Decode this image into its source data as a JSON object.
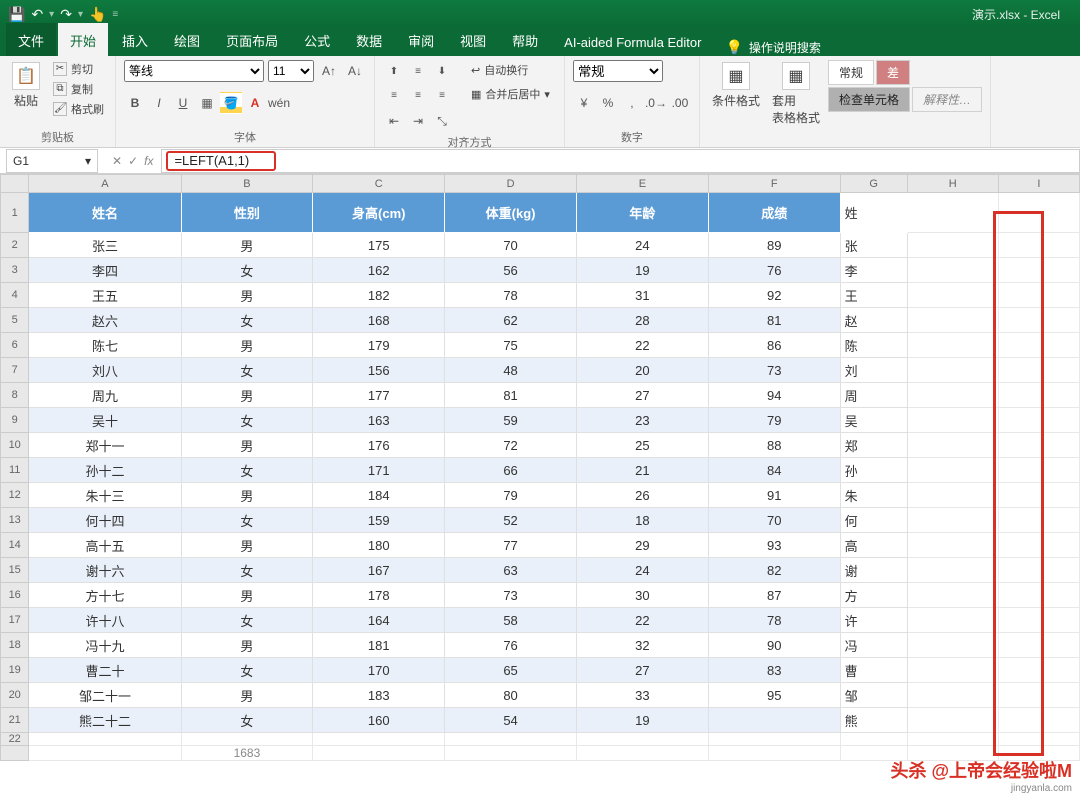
{
  "title": "演示.xlsx - Excel",
  "qat": {
    "save": "💾",
    "undo": "↶",
    "redo": "↷",
    "touch": "👆",
    "sep": "▾"
  },
  "tabs": {
    "file": "文件",
    "home": "开始",
    "insert": "插入",
    "draw": "绘图",
    "layout": "页面布局",
    "formulas": "公式",
    "data": "数据",
    "review": "审阅",
    "view": "视图",
    "help": "帮助",
    "ai": "AI-aided Formula Editor",
    "tell": "操作说明搜索"
  },
  "ribbon": {
    "clipboard": {
      "paste": "粘贴",
      "cut": "剪切",
      "copy": "复制",
      "painter": "格式刷",
      "label": "剪贴板"
    },
    "font": {
      "name": "等线",
      "size": "11",
      "label": "字体"
    },
    "align": {
      "wrap": "自动换行",
      "merge": "合并后居中",
      "label": "对齐方式"
    },
    "number": {
      "format": "常规",
      "label": "数字"
    },
    "styles": {
      "cond": "条件格式",
      "table": "套用\n表格格式",
      "normal": "常规",
      "bad": "差",
      "check": "检查单元格",
      "explain": "解释性…"
    }
  },
  "formula": {
    "cell": "G1",
    "value": "=LEFT(A1,1)"
  },
  "columns": [
    "",
    "A",
    "B",
    "C",
    "D",
    "E",
    "F",
    "G",
    "H",
    "I"
  ],
  "headers": [
    "姓名",
    "性别",
    "身高(cm)",
    "体重(kg)",
    "年龄",
    "成绩"
  ],
  "g_header": "姓",
  "rows": [
    {
      "r": 2,
      "a": "张三",
      "b": "男",
      "c": "175",
      "d": "70",
      "e": "24",
      "f": "89",
      "g": "张"
    },
    {
      "r": 3,
      "a": "李四",
      "b": "女",
      "c": "162",
      "d": "56",
      "e": "19",
      "f": "76",
      "g": "李"
    },
    {
      "r": 4,
      "a": "王五",
      "b": "男",
      "c": "182",
      "d": "78",
      "e": "31",
      "f": "92",
      "g": "王"
    },
    {
      "r": 5,
      "a": "赵六",
      "b": "女",
      "c": "168",
      "d": "62",
      "e": "28",
      "f": "81",
      "g": "赵"
    },
    {
      "r": 6,
      "a": "陈七",
      "b": "男",
      "c": "179",
      "d": "75",
      "e": "22",
      "f": "86",
      "g": "陈"
    },
    {
      "r": 7,
      "a": "刘八",
      "b": "女",
      "c": "156",
      "d": "48",
      "e": "20",
      "f": "73",
      "g": "刘"
    },
    {
      "r": 8,
      "a": "周九",
      "b": "男",
      "c": "177",
      "d": "81",
      "e": "27",
      "f": "94",
      "g": "周"
    },
    {
      "r": 9,
      "a": "吴十",
      "b": "女",
      "c": "163",
      "d": "59",
      "e": "23",
      "f": "79",
      "g": "吴"
    },
    {
      "r": 10,
      "a": "郑十一",
      "b": "男",
      "c": "176",
      "d": "72",
      "e": "25",
      "f": "88",
      "g": "郑"
    },
    {
      "r": 11,
      "a": "孙十二",
      "b": "女",
      "c": "171",
      "d": "66",
      "e": "21",
      "f": "84",
      "g": "孙"
    },
    {
      "r": 12,
      "a": "朱十三",
      "b": "男",
      "c": "184",
      "d": "79",
      "e": "26",
      "f": "91",
      "g": "朱"
    },
    {
      "r": 13,
      "a": "何十四",
      "b": "女",
      "c": "159",
      "d": "52",
      "e": "18",
      "f": "70",
      "g": "何"
    },
    {
      "r": 14,
      "a": "高十五",
      "b": "男",
      "c": "180",
      "d": "77",
      "e": "29",
      "f": "93",
      "g": "高"
    },
    {
      "r": 15,
      "a": "谢十六",
      "b": "女",
      "c": "167",
      "d": "63",
      "e": "24",
      "f": "82",
      "g": "谢"
    },
    {
      "r": 16,
      "a": "方十七",
      "b": "男",
      "c": "178",
      "d": "73",
      "e": "30",
      "f": "87",
      "g": "方"
    },
    {
      "r": 17,
      "a": "许十八",
      "b": "女",
      "c": "164",
      "d": "58",
      "e": "22",
      "f": "78",
      "g": "许"
    },
    {
      "r": 18,
      "a": "冯十九",
      "b": "男",
      "c": "181",
      "d": "76",
      "e": "32",
      "f": "90",
      "g": "冯"
    },
    {
      "r": 19,
      "a": "曹二十",
      "b": "女",
      "c": "170",
      "d": "65",
      "e": "27",
      "f": "83",
      "g": "曹"
    },
    {
      "r": 20,
      "a": "邹二十一",
      "b": "男",
      "c": "183",
      "d": "80",
      "e": "33",
      "f": "95",
      "g": "邹"
    },
    {
      "r": 21,
      "a": "熊二十二",
      "b": "女",
      "c": "160",
      "d": "54",
      "e": "19",
      "f": "",
      "g": "熊"
    }
  ],
  "extra_row": {
    "r": 22
  },
  "footer_num": "1683",
  "branding": {
    "main": "头杀 @上帝会经验啦M",
    "sub": "jingyanla.com"
  }
}
